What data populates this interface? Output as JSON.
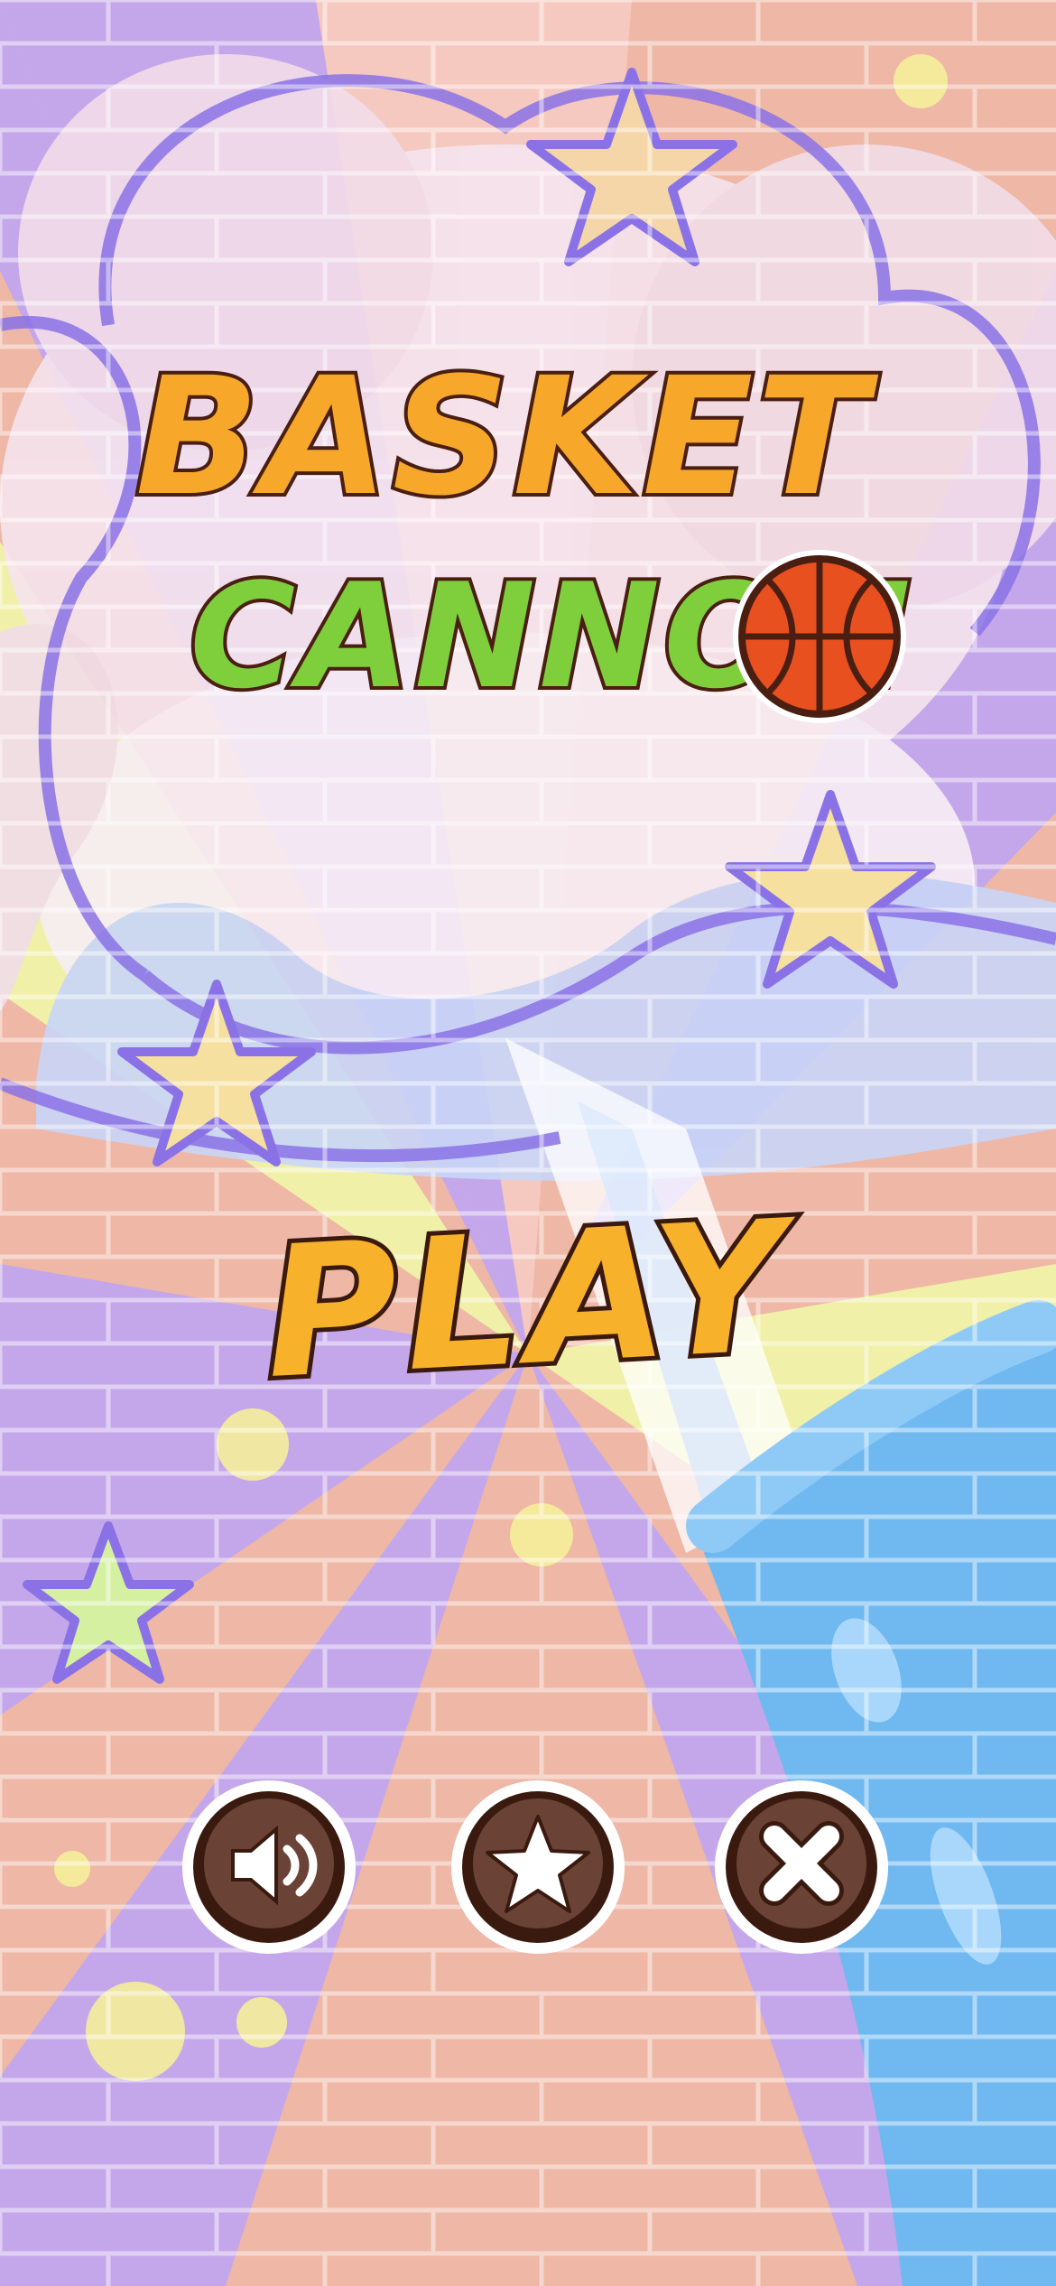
{
  "logo": {
    "line1": "BASKET",
    "line2": "CANNON"
  },
  "play": {
    "label": "PLAY"
  },
  "buttons": [
    {
      "id": "sound",
      "icon": "speaker-icon"
    },
    {
      "id": "rate",
      "icon": "star-icon"
    },
    {
      "id": "close",
      "icon": "close-icon"
    }
  ],
  "colors": {
    "brand_orange": "#f7a82b",
    "brand_green": "#7fcf3c",
    "outline_brown": "#3a1a0f",
    "button_brown": "#6b4336",
    "cannon_blue": "#6fb8f0"
  }
}
